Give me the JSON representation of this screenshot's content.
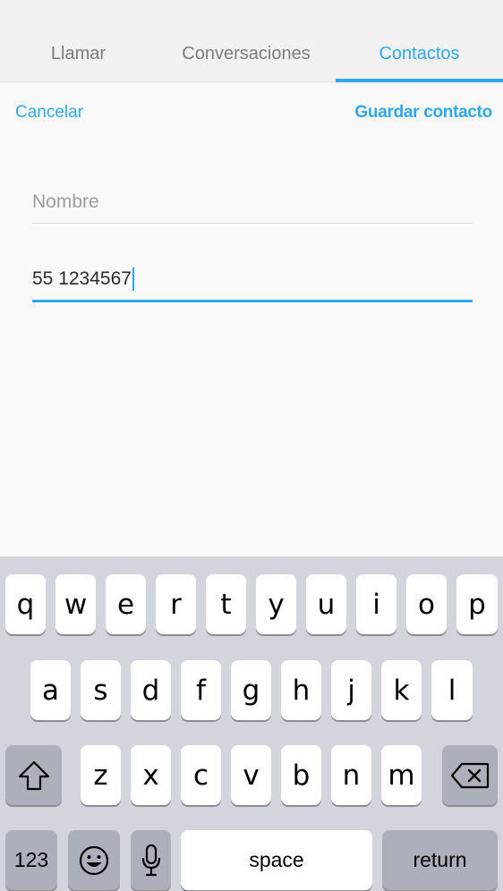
{
  "tabs": [
    {
      "label": "Llamar"
    },
    {
      "label": "Conversaciones"
    },
    {
      "label": "Contactos"
    }
  ],
  "actions": {
    "cancel_label": "Cancelar",
    "save_label": "Guardar contacto"
  },
  "form": {
    "name_placeholder": "Nombre",
    "phone_value": "55 1234567"
  },
  "keyboard": {
    "row1": [
      "q",
      "w",
      "e",
      "r",
      "t",
      "y",
      "u",
      "i",
      "o",
      "p"
    ],
    "row2": [
      "a",
      "s",
      "d",
      "f",
      "g",
      "h",
      "j",
      "k",
      "l"
    ],
    "row3": [
      "z",
      "x",
      "c",
      "v",
      "b",
      "n",
      "m"
    ],
    "numbers_label": "123",
    "space_label": "space",
    "return_label": "return"
  },
  "colors": {
    "accent": "#2da8ef"
  }
}
